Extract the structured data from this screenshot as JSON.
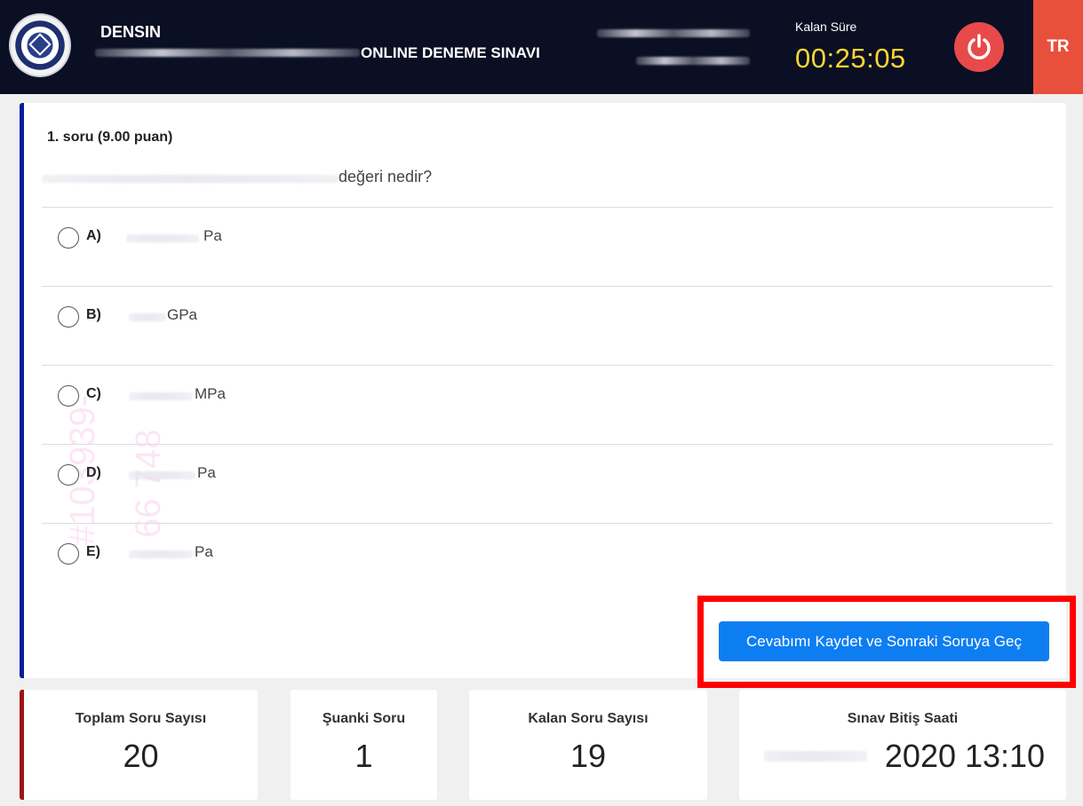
{
  "header": {
    "student_name": "DENSIN",
    "exam_title": "ONLINE DENEME SINAVI",
    "time_label": "Kalan Süre",
    "time_value": "00:25:05",
    "language": "TR",
    "power_icon": "power-icon",
    "logo": "university-logo"
  },
  "question": {
    "number_label": "1. soru (9.00 puan)",
    "text_suffix": "değeri nedir?",
    "options": [
      {
        "letter": "A)",
        "unit": "Pa"
      },
      {
        "letter": "B)",
        "unit": "GPa"
      },
      {
        "letter": "C)",
        "unit": "MPa"
      },
      {
        "letter": "D)",
        "unit": "Pa"
      },
      {
        "letter": "E)",
        "unit": "Pa"
      }
    ],
    "watermark_1": "#103939-",
    "watermark_2": "66 748"
  },
  "submit_button_label": "Cevabımı Kaydet ve Sonraki Soruya Geç",
  "stats": {
    "total": {
      "label": "Toplam Soru Sayısı",
      "value": "20"
    },
    "current": {
      "label": "Şuanki Soru",
      "value": "1"
    },
    "remaining": {
      "label": "Kalan Soru Sayısı",
      "value": "19"
    },
    "end_time": {
      "label": "Sınav Bitiş Saati",
      "value": "2020 13:10"
    }
  },
  "colors": {
    "header_bg": "#0a0f24",
    "accent_blue": "#0d7ef2",
    "timer_yellow": "#ffd72e",
    "power_red": "#e84a4a",
    "lang_bg": "#e8503c",
    "highlight_red": "#ff0000"
  }
}
